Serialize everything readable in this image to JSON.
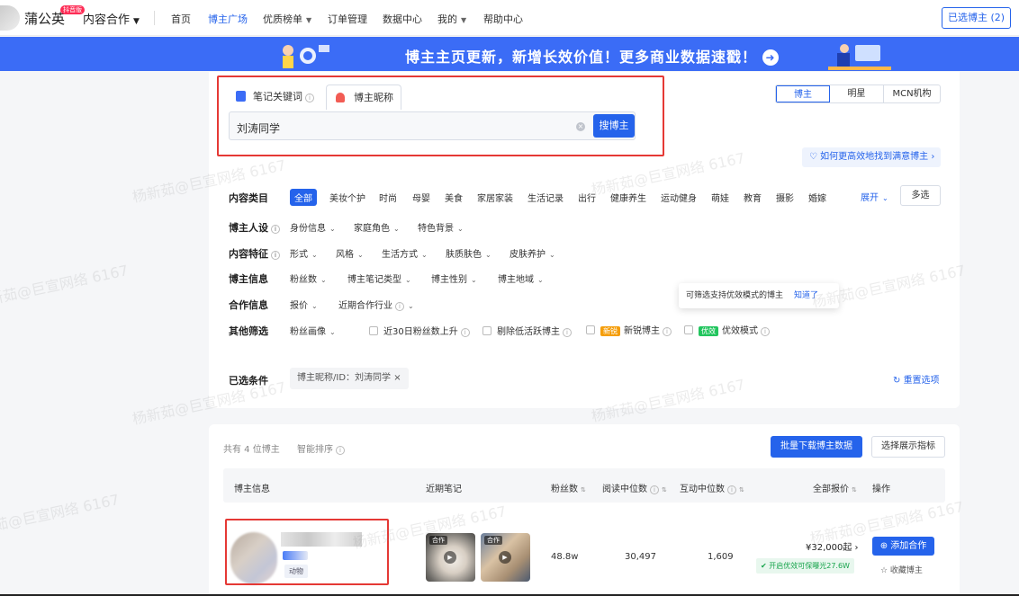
{
  "nav": {
    "brand": "蒲公英",
    "brand_badge": "抖音版",
    "coop": "内容合作",
    "items": [
      "首页",
      "博主广场",
      "优质榜单",
      "订单管理",
      "数据中心",
      "我的",
      "帮助中心"
    ],
    "active": "博主广场",
    "selected_label": "已选博主 (2)"
  },
  "banner": {
    "text": "博主主页更新，新增长效价值！更多商业数据速戳！",
    "arrow": "➜"
  },
  "search": {
    "tab_keyword": "笔记关键词",
    "tab_nickname": "博主昵称",
    "value": "刘涛同学",
    "button": "搜博主",
    "clear": "×"
  },
  "type_tabs": [
    "博主",
    "明星",
    "MCN机构"
  ],
  "help_link": "如何更高效地找到满意博主 ›",
  "filters": {
    "category_label": "内容类目",
    "categories": [
      "全部",
      "美妆个护",
      "时尚",
      "母婴",
      "美食",
      "家居家装",
      "生活记录",
      "出行",
      "健康养生",
      "运动健身",
      "萌娃",
      "教育",
      "摄影",
      "婚嫁"
    ],
    "expand": "展开",
    "multi": "多选",
    "persona_label": "博主人设",
    "persona": [
      "身份信息",
      "家庭角色",
      "特色背景"
    ],
    "feature_label": "内容特征",
    "feature": [
      "形式",
      "风格",
      "生活方式",
      "肤质肤色",
      "皮肤养护"
    ],
    "info_label": "博主信息",
    "info": [
      "粉丝数",
      "博主笔记类型",
      "博主性别",
      "博主地域"
    ],
    "coop_label": "合作信息",
    "coop": [
      "报价",
      "近期合作行业"
    ],
    "other_label": "其他筛选",
    "other_fan": "粉丝画像",
    "chk_rise": "近30日粉丝数上升",
    "chk_inactive": "剔除低活跃博主",
    "tag_new": "新锐",
    "chk_new": "新锐博主",
    "tag_good": "优效",
    "chk_good": "优效模式",
    "tooltip": "可筛选支持优效模式的博主",
    "tooltip_link": "知道了",
    "selected_label": "已选条件",
    "chip": "博主昵称/ID：刘涛同学 ×",
    "reset": "重置选项"
  },
  "results": {
    "count": "共有 4 位博主",
    "smart_sort": "智能排序",
    "download": "批量下载博主数据",
    "choose": "选择展示指标",
    "headers": [
      "博主信息",
      "近期笔记",
      "粉丝数",
      "阅读中位数",
      "互动中位数",
      "全部报价",
      "操作"
    ],
    "row": {
      "category": "动物",
      "thumb_tag": "合作",
      "fans": "48.8w",
      "read_median": "30,497",
      "interact_median": "1,609",
      "price": "¥32,000起 ›",
      "price_badge": "开启优效可保曝光27.6W",
      "add": "⊕ 添加合作",
      "fav": "☆ 收藏博主"
    }
  },
  "watermark": "杨新茹@巨宣网络 6167"
}
